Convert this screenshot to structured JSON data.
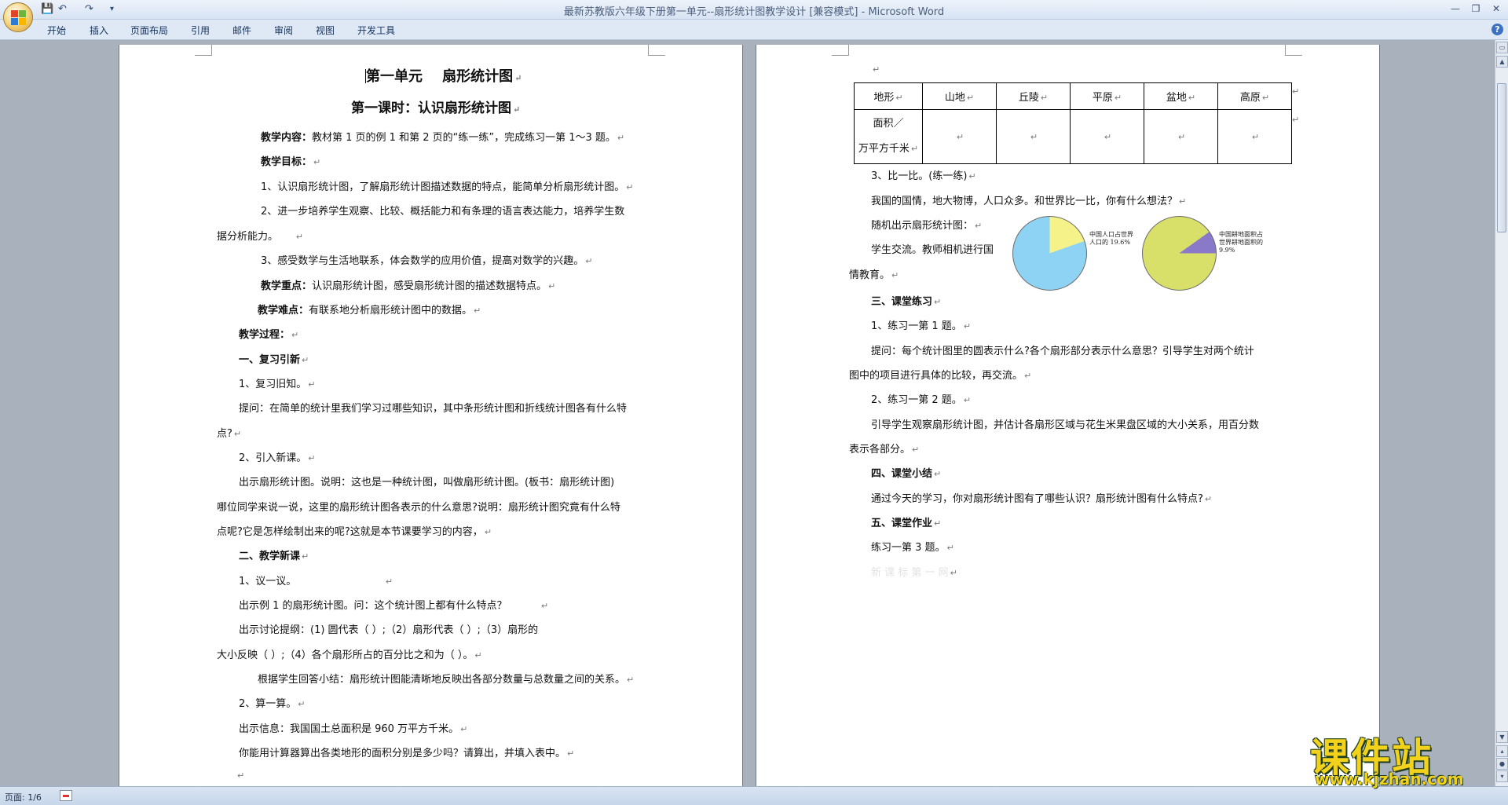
{
  "titlebar": {
    "title": "最新苏教版六年级下册第一单元--扇形统计图教学设计 [兼容模式] - Microsoft Word",
    "quick_access": {
      "save": "💾",
      "undo": "↶",
      "redo": "↷",
      "customize": "▾"
    },
    "controls": {
      "minimize": "—",
      "restore": "❐",
      "close": "✕"
    }
  },
  "ribbon": {
    "tabs": [
      "开始",
      "插入",
      "页面布局",
      "引用",
      "邮件",
      "审阅",
      "视图",
      "开发工具"
    ],
    "help": "?"
  },
  "page1": {
    "title_a": "第一单元",
    "title_b": "扇形统计图",
    "subtitle": "第一课时：认识扇形统计图",
    "content_label": "教学内容：",
    "content_text": "教材第 1 页的例 1 和第 2 页的“练一练”，完成练习一第 1～3 题。",
    "goal_label": "教学目标：",
    "goal1": "1、认识扇形统计图，了解扇形统计图描述数据的特点，能简单分析扇形统计图。",
    "goal2a": "2、进一步培养学生观察、比较、概括能力和有条理的语言表达能力，培养学生数",
    "goal2b": "据分析能力。",
    "goal3": "3、感受数学与生活地联系，体会数学的应用价值，提高对数学的兴趣。",
    "key_label": "教学重点：",
    "key_text": "认识扇形统计图，感受扇形统计图的描述数据特点。",
    "diff_label": "教学难点：",
    "diff_text": "有联系地分析扇形统计图中的数据。",
    "process_label": "教学过程：",
    "s1_heading": "一、复习引新",
    "s1_1": "1、复习旧知。",
    "s1_q_a": "提问：在简单的统计里我们学习过哪些知识，其中条形统计图和折线统计图各有什么特",
    "s1_q_b": "点?",
    "s1_2": "2、引入新课。",
    "intro_a": "出示扇形统计图。说明：这也是一种统计图，叫做扇形统计图。(板书：扇形统计图)",
    "intro_b": "哪位同学来说一说，这里的扇形统计图各表示的什么意思?说明：扇形统计图究竟有什么特",
    "intro_c": "点呢?它是怎样绘制出来的呢?这就是本节课要学习的内容，",
    "s2_heading": "二、教学新课",
    "s2_1": "1、议一议。",
    "s2_show": "出示例 1 的扇形统计图。问：这个统计图上都有什么特点？",
    "s2_outline_a": "出示讨论提纲：(1) 圆代表（              ）;（2）扇形代表（              ）;（3）扇形的",
    "s2_outline_b": "大小反映（              ）;（4）各个扇形所占的百分比之和为（         ）。",
    "s2_summary": "根据学生回答小结：扇形统计图能清晰地反映出各部分数量与总数量之间的关系。",
    "s2_2": "2、算一算。",
    "s2_info": "出示信息：我国国土总面积是 960 万平方千米。",
    "s2_calc": "你能用计算器算出各类地形的面积分别是多少吗？请算出，并填入表中。"
  },
  "page2": {
    "table": {
      "headers": [
        "地形",
        "山地",
        "丘陵",
        "平原",
        "盆地",
        "高原"
      ],
      "row2_label_a": "面积／",
      "row2_label_b": "万平方千米"
    },
    "s3": "3、比一比。(练一练)",
    "s3_text": "我国的国情，地大物博，人口众多。和世界比一比，你有什么想法？",
    "pie_show": "随机出示扇形统计图：",
    "exchange_a": "学生交流。教师相机进行国",
    "exchange_b": "情教育。",
    "pie1_label_a": "中国人口占世界",
    "pie1_label_b": "人口的 19.6%",
    "pie1_percent": 19.6,
    "pie2_label_a": "中国耕地面积占",
    "pie2_label_b": "世界耕地面积的",
    "pie2_label_c": "9.9%",
    "pie2_percent": 9.9,
    "s4_heading": "三、课堂练习",
    "ex1": "1、练习一第 1 题。",
    "ex1_q_a": "提问：每个统计图里的圆表示什么?各个扇形部分表示什么意思？引导学生对两个统计",
    "ex1_q_b": "图中的项目进行具体的比较，再交流。",
    "ex2": "2、练习一第 2 题。",
    "ex2_q_a": "引导学生观察扇形统计图，并估计各扇形区域与花生米果盘区域的大小关系，用百分数",
    "ex2_q_b": "表示各部分。",
    "s5_heading": "四、课堂小结",
    "summary_text": "通过今天的学习，你对扇形统计图有了哪些认识？扇形统计图有什么特点?",
    "s6_heading": "五、课堂作业",
    "homework": "练习一第 3 题。",
    "faint": "新 课 标 第 一 网"
  },
  "marks": {
    "para": "↵"
  },
  "status": {
    "page": "页面: 1/6"
  },
  "watermark": {
    "cn": "课件站",
    "url": "www.kjzhan.com"
  },
  "colors": {
    "pie_blue": "#8fd3f4",
    "pie_yellow": "#f6f28a",
    "pie_green": "#d9e06a",
    "pie_purple": "#8a78c8"
  }
}
